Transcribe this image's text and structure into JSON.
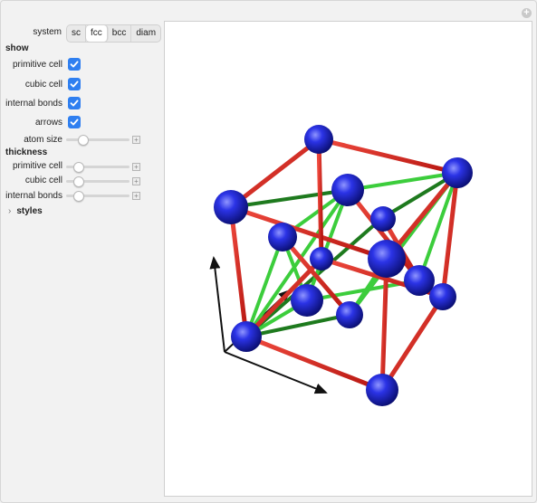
{
  "window": {
    "corner_button": "+"
  },
  "controls": {
    "system": {
      "label": "system",
      "options": [
        "sc",
        "fcc",
        "bcc",
        "diam"
      ],
      "selected": "fcc"
    },
    "show": {
      "heading": "show",
      "checkboxes": [
        {
          "label": "primitive cell",
          "checked": true
        },
        {
          "label": "cubic cell",
          "checked": true
        },
        {
          "label": "internal bonds",
          "checked": true
        },
        {
          "label": "arrows",
          "checked": true
        }
      ],
      "atom_size": {
        "label": "atom size",
        "level": 0.25
      }
    },
    "thickness": {
      "heading": "thickness",
      "sliders": [
        {
          "label": "primitive cell",
          "level": 0.15
        },
        {
          "label": "cubic cell",
          "level": 0.15
        },
        {
          "label": "internal bonds",
          "level": 0.15
        }
      ]
    },
    "styles": {
      "label": "styles"
    }
  },
  "colors": {
    "accent": "#2f7ff0",
    "cubic_bond": "#d9201a",
    "primitive_bond": "#34c834",
    "internal_bond": "#1e7a1e",
    "atom": "#1a22d8",
    "arrow": "#111111"
  }
}
